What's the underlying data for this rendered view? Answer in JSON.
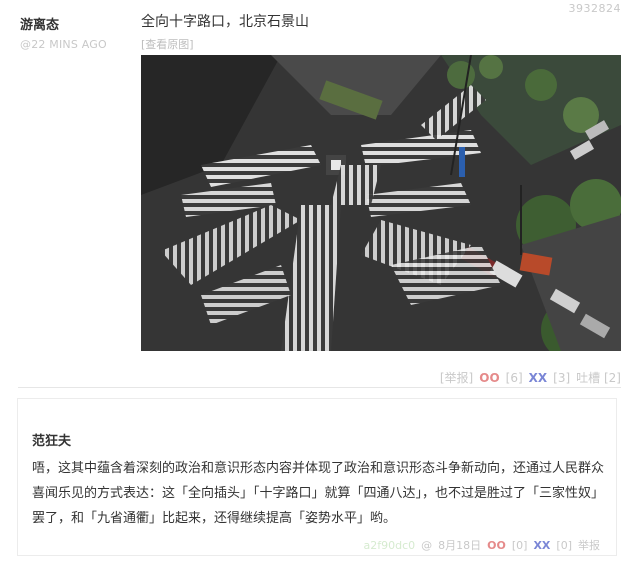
{
  "post": {
    "id": "3932824",
    "author": "游离态",
    "time": "@22 MINS AGO",
    "text": "全向十字路口，北京石景山",
    "view_original": "[查看原图]",
    "image_subject": "aerial view of an omnidirectional crosswalk intersection",
    "actions": {
      "report": "[举报]",
      "oo_label": "OO",
      "oo_count": "[6]",
      "xx_label": "XX",
      "xx_count": "[3]",
      "tucao": "吐槽 [2]"
    }
  },
  "comment": {
    "author": "范狂夫",
    "text": "唔，这其中蕴含着深刻的政治和意识形态内容并体现了政治和意识形态斗争新动向，还通过人民群众喜闻乐见的方式表达：这「全向插头」「十字路口」就算「四通八达」，也不过是胜过了「三家性奴」罢了，和「九省通衢」比起来，还得继续提高「姿势水平」哟。",
    "hash": "a2f90dc0",
    "at": "@",
    "date": "8月18日",
    "oo_label": "OO",
    "oo_count": "[0]",
    "xx_label": "XX",
    "xx_count": "[0]",
    "report": "举报"
  },
  "colors": {
    "oo": "#e58a8a",
    "xx": "#7a86d6",
    "muted": "#c9c9c9"
  }
}
